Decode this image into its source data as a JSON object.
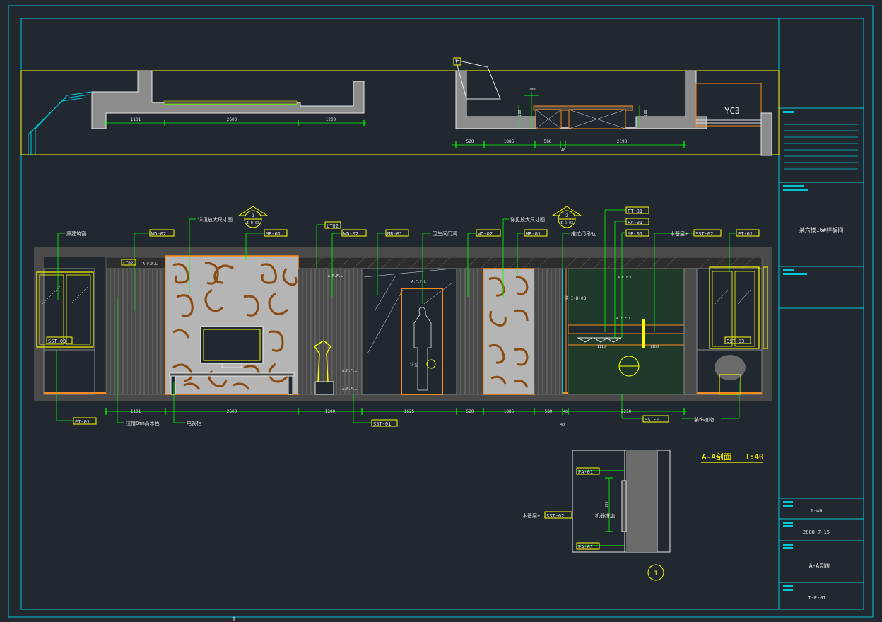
{
  "colors": {
    "background": "#212830",
    "frame": "#00c8d7",
    "white": "#e6e6e6",
    "green": "#00ff00",
    "yellow": "#ffff00",
    "orange": "#ff8c1a",
    "gray": "#8c8c8c",
    "dark_gray": "#4a4a4a",
    "label_box": "#ffff00"
  },
  "plan": {
    "room_tag": "YC3",
    "dims_left": [
      "1101",
      "2600",
      "1200"
    ],
    "dims_right": [
      "520",
      "1885",
      "580",
      "40",
      "2190"
    ],
    "dims_vertical": [
      "100",
      "280",
      "280"
    ]
  },
  "elevation": {
    "title": "A-A剖面",
    "scale": "1:40",
    "bottom_dims": [
      "1101",
      "2600",
      "1200",
      "1625",
      "520",
      "1885",
      "580",
      "40",
      "2210"
    ],
    "bottom_small": "40",
    "detail_tag_1": {
      "num": "1",
      "ref": "I-D-03"
    },
    "detail_tag_2": {
      "num": "2",
      "ref": "I-D-03"
    },
    "notes_top": [
      {
        "key": "n1",
        "text": "原建筑窗"
      },
      {
        "key": "n2",
        "text": "WD-02",
        "boxed": true
      },
      {
        "key": "n3",
        "text": "详见放大尺寸图"
      },
      {
        "key": "n4",
        "text": "MR-01",
        "boxed": true
      },
      {
        "key": "n5",
        "text": "LT02",
        "boxed": true
      },
      {
        "key": "n6",
        "text": "WD-02",
        "boxed": true
      },
      {
        "key": "n7",
        "text": "MR-01",
        "boxed": true
      },
      {
        "key": "n8",
        "text": "卫生间门洞"
      },
      {
        "key": "n9",
        "text": "WD-02",
        "boxed": true
      },
      {
        "key": "n10",
        "text": "详见放大尺寸图"
      },
      {
        "key": "n11",
        "text": "MR-01",
        "boxed": true
      },
      {
        "key": "n12",
        "text": "推拉门吊轨"
      },
      {
        "key": "n13",
        "text": "PT-01",
        "boxed": true
      },
      {
        "key": "n14",
        "text": "PA-01",
        "boxed": true
      },
      {
        "key": "n15",
        "text": "MR-01",
        "boxed": true
      },
      {
        "key": "n16",
        "text": "木基层+"
      },
      {
        "key": "n17",
        "text": "SST-02",
        "boxed": true
      },
      {
        "key": "n18",
        "text": "PT-01",
        "boxed": true
      }
    ],
    "notes_inner": {
      "lt02": "LT02",
      "sst03_left": "SST-03",
      "sst03_right": "SST-03",
      "aff1": "A.F.F.L",
      "aff2": "A.F.F.L",
      "aff3": "A.F.F.L",
      "aff4": "A.F.F.L",
      "aff5": "A.F.F.L",
      "aff6": "A.F.F.L",
      "aff7": "A.F.F.L",
      "detail_ref": "详 I-D-03",
      "detail_ref2": "详见",
      "dim_inner1": "1110",
      "dim_inner2": "1100"
    },
    "notes_bottom": {
      "pt01": "PT-01",
      "wood": "拉槽8mm高木色",
      "tv": "电视柜",
      "sst01a": "SST-01",
      "sst01b": "SST-01",
      "plant": "装饰植物"
    }
  },
  "section_detail": {
    "pa01_top": "PA-01",
    "pa01_bottom": "PA-01",
    "left_note": "木基层+",
    "sst02": "SST-02",
    "center_note": "机器拼边",
    "dim": "300",
    "circle_num": "1"
  },
  "title_block": {
    "project": "某六楼16#样板间",
    "scale": "1:40",
    "date": "2008-7-15",
    "drawing_name": "A-A剖面",
    "drawing_no": "I-E-01"
  },
  "axis_marker": "Y"
}
